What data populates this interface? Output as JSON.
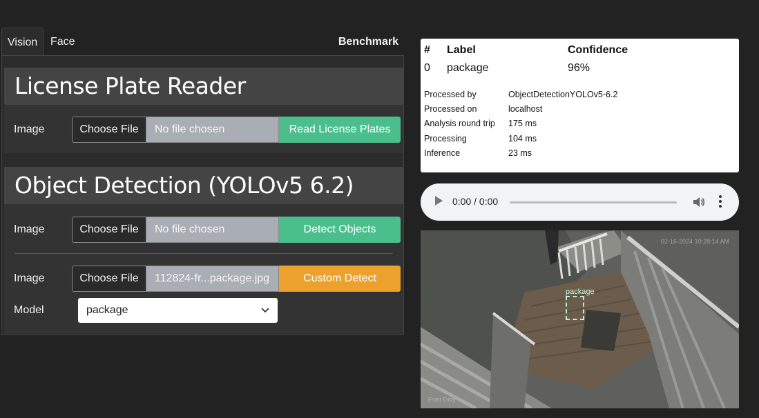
{
  "tabs": [
    {
      "label": "Vision",
      "active": true
    },
    {
      "label": "Face",
      "active": false
    },
    {
      "label": "Benchmark",
      "active": false
    }
  ],
  "lpr": {
    "title": "License Plate Reader",
    "image_label": "Image",
    "choose_label": "Choose File",
    "file_name": "No file chosen",
    "action_label": "Read License Plates"
  },
  "od": {
    "title": "Object Detection (YOLOv5 6.2)",
    "image_label": "Image",
    "choose_label": "Choose File",
    "file_name": "No file chosen",
    "action_label": "Detect Objects",
    "custom": {
      "image_label": "Image",
      "choose_label": "Choose File",
      "file_name": "112824-fr...package.jpg",
      "action_label": "Custom Detect",
      "model_label": "Model",
      "model_value": "package"
    }
  },
  "results": {
    "headers": [
      "#",
      "Label",
      "Confidence"
    ],
    "rows": [
      {
        "index": "0",
        "label": "package",
        "confidence": "96%"
      }
    ],
    "meta": [
      {
        "label": "Processed by",
        "value": "ObjectDetectionYOLOv5-6.2"
      },
      {
        "label": "Processed on",
        "value": "localhost"
      },
      {
        "label": "Analysis round trip",
        "value": "175 ms"
      },
      {
        "label": "Processing",
        "value": "104 ms"
      },
      {
        "label": "Inference",
        "value": "23 ms"
      }
    ]
  },
  "audio": {
    "time": "0:00 / 0:00",
    "progress": 0
  },
  "camera": {
    "timestamp": "02-16-2024 10:28:14 AM",
    "camera_name": "Front Entry",
    "detection_label": "package"
  },
  "colors": {
    "background": "#222222",
    "green_button": "#4abf8c",
    "orange_button": "#eba12c",
    "detection_box": "#b9f0d5"
  }
}
